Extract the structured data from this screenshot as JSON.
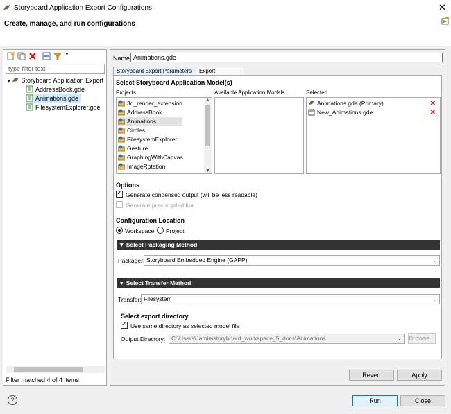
{
  "window": {
    "title": "Storyboard Application Export Configurations",
    "close_glyph": "✕"
  },
  "banner": {
    "heading": "Create, manage, and run configurations"
  },
  "left": {
    "filter_placeholder": "type filter text",
    "tree": [
      {
        "label": "Storyboard Application Export",
        "indent": 0,
        "expanded": true
      },
      {
        "label": "AddressBook.gde",
        "indent": 1
      },
      {
        "label": "Animations.gde",
        "indent": 1,
        "selected": true
      },
      {
        "label": "FilesystemExplorer.gde",
        "indent": 1
      }
    ],
    "status": "Filter matched 4 of 4 items"
  },
  "config": {
    "name_label": "Name:",
    "name_value": "Animations.gde",
    "tabs": [
      "Storyboard Export Parameters",
      "Export Resources"
    ],
    "models_title": "Select Storyboard Application Model(s)",
    "col_projects": "Projects",
    "col_available": "Available Application Models",
    "col_selected": "Selected",
    "projects": [
      "3d_render_extension",
      "AddressBook",
      "Animations",
      "Circles",
      "FilesystemExplorer",
      "Gesture",
      "GraphingWithCanvas",
      "ImageRotation"
    ],
    "selected_models": [
      "Animations.gde (Primary)",
      "New_Animations.gde"
    ],
    "options_title": "Options",
    "opt_condensed": "Generate condensed output (will be less readable)",
    "opt_precompiled": "Generate precompiled lua",
    "location_title": "Configuration Location",
    "loc_workspace": "Workspace",
    "loc_project": "Project",
    "packaging_bar": "Select Packaging Method",
    "packager_label": "Packager:",
    "packager_value": "Storyboard Embedded Engine (GAPP)",
    "transfer_bar": "Select Transfer Method",
    "transfer_label": "Transfer:",
    "transfer_value": "Filesystem",
    "export_dir_title": "Select export directory",
    "use_same_dir": "Use same directory as selected model file",
    "output_dir_label": "Output Directory:",
    "output_dir_value": "C:\\Users\\Jamie\\storyboard_workspace_5_docs\\Animations",
    "browse": "Browse..."
  },
  "buttons": {
    "revert": "Revert",
    "apply": "Apply",
    "run": "Run",
    "close": "Close",
    "help": "?"
  },
  "colors": {
    "selection": "#cde8ff",
    "section_bar": "#333333",
    "remove": "#d01c1c",
    "default_button": "#0078d7"
  }
}
